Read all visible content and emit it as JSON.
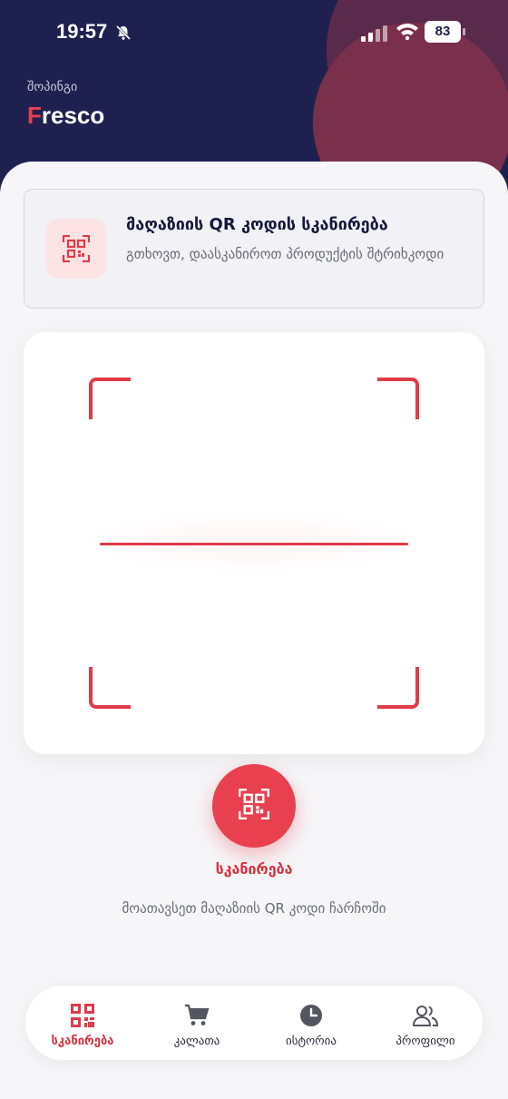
{
  "status_bar": {
    "time": "19:57",
    "battery": "83"
  },
  "header": {
    "subtitle": "შოპინგი",
    "brand_first": "F",
    "brand_rest": "resco"
  },
  "info_card": {
    "title": "მაღაზიის QR კოდის სკანირება",
    "description": "გთხოვთ, დაასკანიროთ პროდუქტის შტრიხკოდი"
  },
  "scan": {
    "button_label": "სკანირება",
    "hint": "მოათავსეთ მაღაზიის QR კოდი ჩარჩოში"
  },
  "nav": {
    "items": [
      {
        "label": "სკანირება",
        "icon": "qr-icon",
        "active": true
      },
      {
        "label": "კალათა",
        "icon": "cart-icon",
        "active": false
      },
      {
        "label": "ისტორია",
        "icon": "clock-icon",
        "active": false
      },
      {
        "label": "პროფილი",
        "icon": "users-icon",
        "active": false
      }
    ]
  },
  "colors": {
    "accent": "#e8404e",
    "header_bg": "#1e2150"
  }
}
